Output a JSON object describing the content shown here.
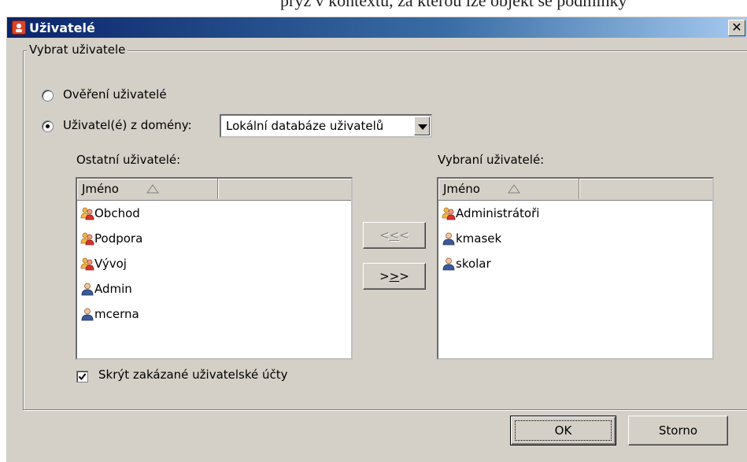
{
  "page_top_text": "pryž v kontextu, za kterou lze objekt se podmínky",
  "window": {
    "title": "Uživatelé",
    "close_glyph": "✕"
  },
  "group": {
    "legend": "Vybrat uživatele",
    "radio_verified": {
      "label": "Ověření uživatelé",
      "checked": false
    },
    "radio_domain": {
      "label": "Uživatel(é) z domény:",
      "checked": true
    },
    "domain_select": {
      "value": "Lokální databáze uživatelů"
    }
  },
  "left_list": {
    "label": "Ostatní uživatelé:",
    "column": "Jméno",
    "items": [
      {
        "name": "Obchod",
        "icon": "group-icon"
      },
      {
        "name": "Podpora",
        "icon": "group-icon"
      },
      {
        "name": "Vývoj",
        "icon": "group-icon"
      },
      {
        "name": "Admin",
        "icon": "user-icon"
      },
      {
        "name": "mcerna",
        "icon": "user-icon"
      }
    ]
  },
  "right_list": {
    "label": "Vybraní uživatelé:",
    "column": "Jméno",
    "items": [
      {
        "name": "Administrátoři",
        "icon": "group-icon"
      },
      {
        "name": "kmasek",
        "icon": "user-icon"
      },
      {
        "name": "skolar",
        "icon": "user-icon"
      }
    ]
  },
  "move_buttons": {
    "remove": {
      "pre": "<",
      "underlined": "<",
      "post": "<"
    },
    "add": {
      "pre": ">",
      "underlined": ">",
      "post": ">"
    }
  },
  "hide_disabled": {
    "label": "Skrýt zakázané uživatelské účty",
    "checked": true
  },
  "footer": {
    "ok": "OK",
    "cancel": "Storno"
  }
}
